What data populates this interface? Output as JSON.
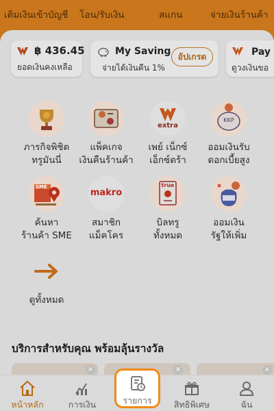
{
  "top_actions": [
    {
      "label": "เติมเงินเข้าบัญชี"
    },
    {
      "label": "โอน/รับเงิน"
    },
    {
      "label": "สแกน"
    },
    {
      "label": "จ่ายเงินร้านค้า"
    }
  ],
  "balance_card": {
    "amount": "฿ 436.45",
    "subtitle": "ยอดเงินคงเหลือ"
  },
  "saving_card": {
    "title": "My Saving",
    "subtitle": "จ่ายได้เงินคืน 1%",
    "button": "อัปเกรด"
  },
  "paynext_card": {
    "title": "Pay N",
    "subtitle": "ดูวงเงินขอ"
  },
  "services": [
    {
      "line1": "ภารกิจพิชิต",
      "line2": "ทรูมันนี่",
      "icon": "trophy-icon"
    },
    {
      "line1": "แพ็คเกจ",
      "line2": "เงินคืนร้านค้า",
      "icon": "cashback-package-icon"
    },
    {
      "line1": "เพย์ เน็กซ์",
      "line2": "เอ็กซ์ตร้า",
      "icon": "pay-next-extra-icon",
      "badge": "extra"
    },
    {
      "line1": "ออมเงินรับ",
      "line2": "ดอกเบี้ยสูง",
      "icon": "kkp-savings-icon",
      "badge": "KKP"
    },
    {
      "line1": "ค้นหา",
      "line2": "ร้านค้า SME",
      "icon": "sme-store-icon",
      "badge": "SME"
    },
    {
      "line1": "สมาชิก",
      "line2": "แม็คโคร",
      "icon": "makro-icon",
      "badge": "makro"
    },
    {
      "line1": "บิลทรู",
      "line2": "ทั้งหมด",
      "icon": "true-bill-icon",
      "badge": "true"
    },
    {
      "line1": "ออมเงิน",
      "line2": "รัฐให้เพิ่ม",
      "icon": "gov-savings-icon"
    },
    {
      "line1": "ดูทั้งหมด",
      "line2": "",
      "icon": "arrow-right-icon"
    }
  ],
  "section": {
    "title": "บริการสำหรับคุณ พร้อมลุ้นรางวัล"
  },
  "bottom_nav": [
    {
      "label": "หน้าหลัก",
      "icon": "home-icon",
      "active": true
    },
    {
      "label": "การเงิน",
      "icon": "finance-icon",
      "active": false
    },
    {
      "label": "รายการ",
      "icon": "transactions-icon",
      "active": false
    },
    {
      "label": "สิทธิพิเศษ",
      "icon": "gift-icon",
      "active": false
    },
    {
      "label": "ฉัน",
      "icon": "profile-icon",
      "active": false
    }
  ],
  "colors": {
    "accent": "#f08a12",
    "header": "#c9761c",
    "overlay": "#d7d7d7"
  }
}
